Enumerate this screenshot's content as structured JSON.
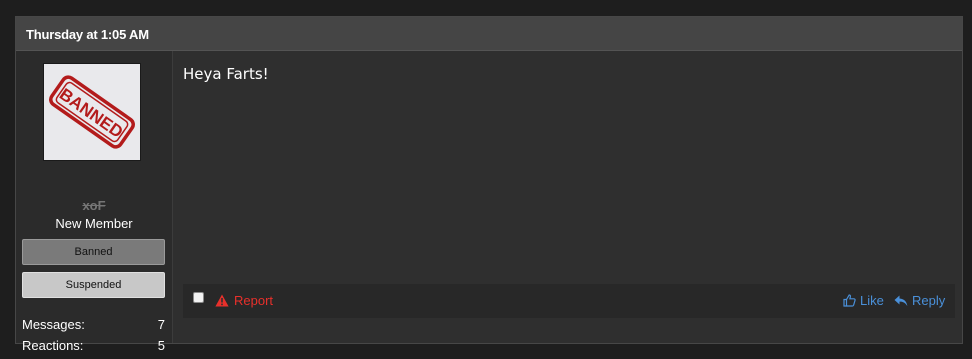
{
  "post": {
    "date": "Thursday at 1:05 AM",
    "message": "Heya Farts!"
  },
  "user": {
    "avatar_stamp_text": "BANNED",
    "username": "xoF",
    "title": "New Member",
    "banners": [
      "Banned",
      "Suspended"
    ],
    "stats": [
      {
        "label": "Messages:",
        "value": "7"
      },
      {
        "label": "Reactions:",
        "value": "5"
      }
    ]
  },
  "actions": {
    "report": "Report",
    "like": "Like",
    "reply": "Reply",
    "report_color": "#e8302b",
    "link_color": "#4a90d9"
  },
  "icons": {
    "report": "warning-triangle-icon",
    "like": "thumbs-up-icon",
    "reply": "reply-arrow-icon"
  }
}
